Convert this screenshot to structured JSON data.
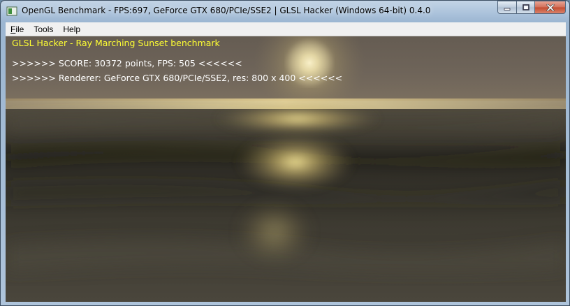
{
  "window": {
    "title": "OpenGL Benchmark - FPS:697, GeForce GTX 680/PCIe/SSE2 | GLSL Hacker (Windows 64-bit) 0.4.0",
    "controls": [
      "minimize-icon",
      "maximize-icon",
      "close-icon"
    ]
  },
  "menu": {
    "file_first": "F",
    "file_rest": "ile",
    "tools": "Tools",
    "help": "Help"
  },
  "overlay": {
    "heading": "GLSL Hacker - Ray Marching Sunset benchmark",
    "score_line": ">>>>>> SCORE: 30372 points, FPS: 505 <<<<<<",
    "renderer_line": ">>>>>> Renderer: GeForce GTX 680/PCIe/SSE2, res: 800 x 400 <<<<<<"
  },
  "colors": {
    "heading": "#ffff33",
    "text": "#ffffff",
    "sky": "#6f655a",
    "sun": "#fff2a8",
    "sea_dark": "#1e1d18"
  }
}
